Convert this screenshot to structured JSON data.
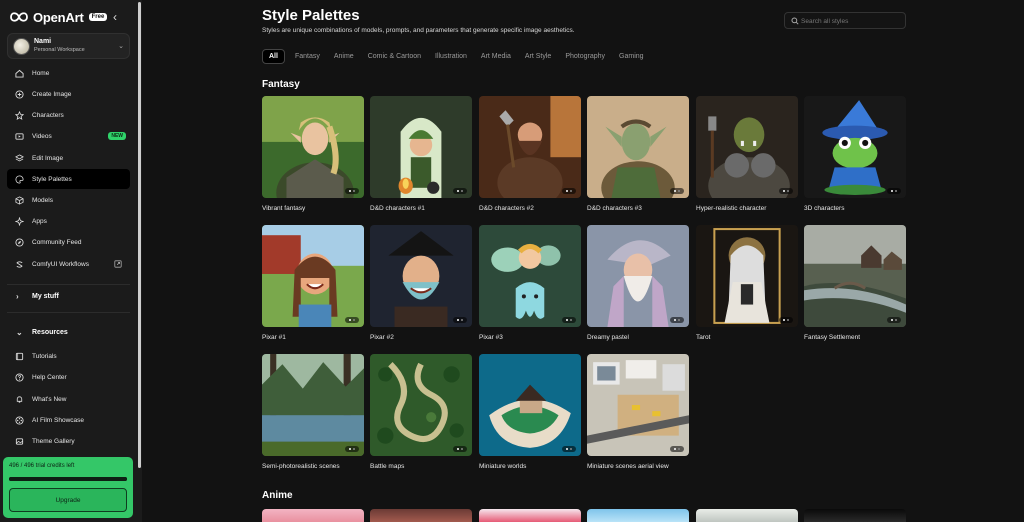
{
  "brand": {
    "name": "OpenArt",
    "plan": "Free"
  },
  "workspace": {
    "name": "Nami",
    "subtitle": "Personal Workspace"
  },
  "nav": [
    {
      "label": "Home",
      "icon": "home-icon"
    },
    {
      "label": "Create Image",
      "icon": "plus-circle-icon"
    },
    {
      "label": "Characters",
      "icon": "star-icon"
    },
    {
      "label": "Videos",
      "icon": "video-icon",
      "badge": "NEW"
    },
    {
      "label": "Edit Image",
      "icon": "layers-icon"
    },
    {
      "label": "Style Palettes",
      "icon": "palette-icon",
      "active": true
    },
    {
      "label": "Models",
      "icon": "cube-icon"
    },
    {
      "label": "Apps",
      "icon": "sparkle-icon"
    },
    {
      "label": "Community Feed",
      "icon": "compass-icon"
    },
    {
      "label": "ComfyUI Workflows",
      "icon": "workflow-icon"
    }
  ],
  "my_stuff": "My stuff",
  "resources": {
    "label": "Resources",
    "items": [
      {
        "label": "Tutorials",
        "icon": "book-icon"
      },
      {
        "label": "Help Center",
        "icon": "help-icon"
      },
      {
        "label": "What's New",
        "icon": "bell-icon"
      },
      {
        "label": "AI Film Showcase",
        "icon": "film-icon"
      },
      {
        "label": "Theme Gallery",
        "icon": "gallery-icon"
      }
    ]
  },
  "credits": {
    "text": "496 / 496 trial credits left",
    "used_fraction": 1.0,
    "upgrade_label": "Upgrade"
  },
  "page": {
    "title": "Style Palettes",
    "subtitle": "Styles are unique combinations of models, prompts, and parameters that generate specific image aesthetics."
  },
  "search": {
    "placeholder": "Search all styles"
  },
  "tabs": [
    "All",
    "Fantasy",
    "Anime",
    "Comic & Cartoon",
    "Illustration",
    "Art Media",
    "Art Style",
    "Photography",
    "Gaming"
  ],
  "sections": [
    {
      "title": "Fantasy",
      "cards": [
        {
          "label": "Vibrant fantasy",
          "art": "elf-warrior"
        },
        {
          "label": "D&D characters #1",
          "art": "gnome-archway"
        },
        {
          "label": "D&D characters #2",
          "art": "dwarf-tavern"
        },
        {
          "label": "D&D characters #3",
          "art": "green-elf"
        },
        {
          "label": "Hyper-realistic character",
          "art": "orc-warrior"
        },
        {
          "label": "3D characters",
          "art": "frog-wizard"
        },
        {
          "label": "Pixar #1",
          "art": "farm-girl"
        },
        {
          "label": "Pixar #2",
          "art": "pirate"
        },
        {
          "label": "Pixar #3",
          "art": "fairy-tooth"
        },
        {
          "label": "Dreamy pastel",
          "art": "old-wizard"
        },
        {
          "label": "Tarot",
          "art": "tarot-queen"
        },
        {
          "label": "Fantasy Settlement",
          "art": "village-river"
        },
        {
          "label": "Semi-photorealistic scenes",
          "art": "forest-lake"
        },
        {
          "label": "Battle maps",
          "art": "battle-map"
        },
        {
          "label": "Miniature worlds",
          "art": "island-hut"
        },
        {
          "label": "Miniature scenes aerial view",
          "art": "aerial-city"
        }
      ]
    },
    {
      "title": "Anime"
    }
  ]
}
